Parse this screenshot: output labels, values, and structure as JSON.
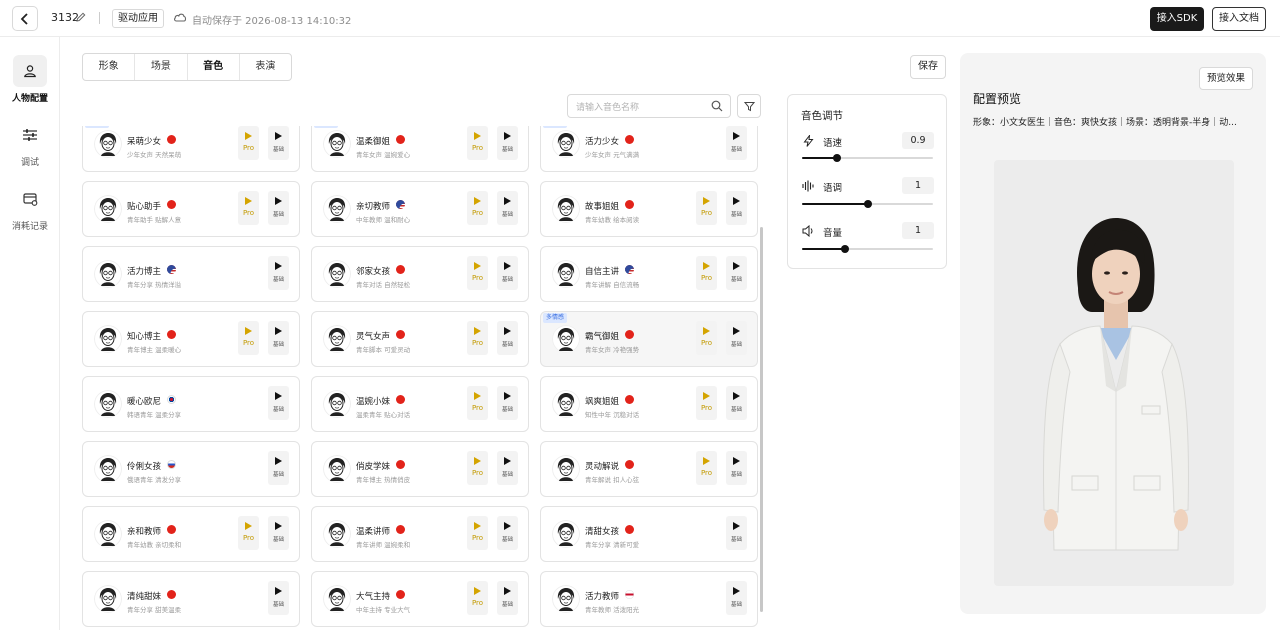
{
  "topbar": {
    "project_name": "3132",
    "badge": "驱动应用",
    "autosave": "自动保存于 2026-08-13 14:10:32",
    "sdk_button": "接入SDK",
    "doc_button": "接入文档"
  },
  "sidebar": {
    "items": [
      {
        "label": "人物配置",
        "icon": "person-icon",
        "active": true
      },
      {
        "label": "调试",
        "icon": "sliders-icon",
        "active": false
      },
      {
        "label": "消耗记录",
        "icon": "record-icon",
        "active": false
      }
    ]
  },
  "tabs": [
    {
      "label": "形象",
      "active": false
    },
    {
      "label": "场景",
      "active": false
    },
    {
      "label": "音色",
      "active": true
    },
    {
      "label": "表演",
      "active": false
    }
  ],
  "save_button": "保存",
  "search": {
    "placeholder": "请输入音色名称"
  },
  "voice_card_labels": {
    "pro": "Pro",
    "base": "基础",
    "multi": "多情感"
  },
  "voices": [
    {
      "name": "呆萌少女",
      "desc": "少年女声 天然呆萌",
      "flag": "cn",
      "pro": true,
      "multi": true
    },
    {
      "name": "温柔御姐",
      "desc": "青年女声 温婉爱心",
      "flag": "cn",
      "pro": true,
      "multi": true
    },
    {
      "name": "活力少女",
      "desc": "少年女声 元气满满",
      "flag": "cn",
      "pro": false,
      "multi": true
    },
    {
      "name": "贴心助手",
      "desc": "青年助手 贴解人意",
      "flag": "cn",
      "pro": true,
      "multi": false
    },
    {
      "name": "亲切教师",
      "desc": "中年教师 温和耐心",
      "flag": "us",
      "pro": true,
      "multi": false
    },
    {
      "name": "故事姐姐",
      "desc": "青年幼教 绘本阅读",
      "flag": "cn",
      "pro": true,
      "multi": false
    },
    {
      "name": "活力博主",
      "desc": "青年分享 热情洋溢",
      "flag": "us",
      "pro": false,
      "multi": false
    },
    {
      "name": "邻家女孩",
      "desc": "青年对话 自然轻松",
      "flag": "cn",
      "pro": true,
      "multi": false
    },
    {
      "name": "自信主讲",
      "desc": "青年讲解 自信流畅",
      "flag": "us",
      "pro": true,
      "multi": false
    },
    {
      "name": "知心博主",
      "desc": "青年博主 温柔暖心",
      "flag": "cn",
      "pro": true,
      "multi": false
    },
    {
      "name": "灵气女声",
      "desc": "青年脚本 可爱灵动",
      "flag": "cn",
      "pro": true,
      "multi": false
    },
    {
      "name": "霸气御姐",
      "desc": "青年女声 冷艳强势",
      "flag": "cn",
      "pro": true,
      "multi": true,
      "selected": true
    },
    {
      "name": "暖心欧尼",
      "desc": "韩语青年 温柔分享",
      "flag": "kr",
      "pro": false,
      "multi": false
    },
    {
      "name": "温婉小妹",
      "desc": "温柔青年 贴心对话",
      "flag": "cn",
      "pro": true,
      "multi": false
    },
    {
      "name": "飒爽姐姐",
      "desc": "知性中年 沉稳对话",
      "flag": "cn",
      "pro": true,
      "multi": false
    },
    {
      "name": "伶俐女孩",
      "desc": "俄语青年 清发分享",
      "flag": "ru",
      "pro": false,
      "multi": false
    },
    {
      "name": "俏皮学妹",
      "desc": "青年博主 热情俏皮",
      "flag": "cn",
      "pro": true,
      "multi": false
    },
    {
      "name": "灵动解说",
      "desc": "青年解说 扣人心弦",
      "flag": "cn",
      "pro": true,
      "multi": false
    },
    {
      "name": "亲和教师",
      "desc": "青年幼教 亲切柔和",
      "flag": "cn",
      "pro": true,
      "multi": false
    },
    {
      "name": "温柔讲师",
      "desc": "青年讲师 温婉柔和",
      "flag": "cn",
      "pro": true,
      "multi": false
    },
    {
      "name": "清甜女孩",
      "desc": "青年分享 清新可爱",
      "flag": "cn",
      "pro": false,
      "multi": false
    },
    {
      "name": "清纯甜妹",
      "desc": "青年分享 甜美温柔",
      "flag": "cn",
      "pro": false,
      "multi": false
    },
    {
      "name": "大气主持",
      "desc": "中年主持 专业大气",
      "flag": "cn",
      "pro": true,
      "multi": false
    },
    {
      "name": "活力教师",
      "desc": "青年教师 活泼阳光",
      "flag": "gb",
      "pro": false,
      "multi": false
    }
  ],
  "tone": {
    "title": "音色调节",
    "params": [
      {
        "label": "语速",
        "value": "0.9",
        "fraction": 0.27,
        "icon": "bolt-icon"
      },
      {
        "label": "语调",
        "value": "1",
        "fraction": 0.5,
        "icon": "waveform-icon"
      },
      {
        "label": "音量",
        "value": "1",
        "fraction": 0.33,
        "icon": "speaker-icon"
      }
    ]
  },
  "preview": {
    "button": "预览效果",
    "title": "配置预览",
    "meta": "形象：小文女医生｜音色：爽快女孩｜场景：透明背景-半身｜动..."
  }
}
